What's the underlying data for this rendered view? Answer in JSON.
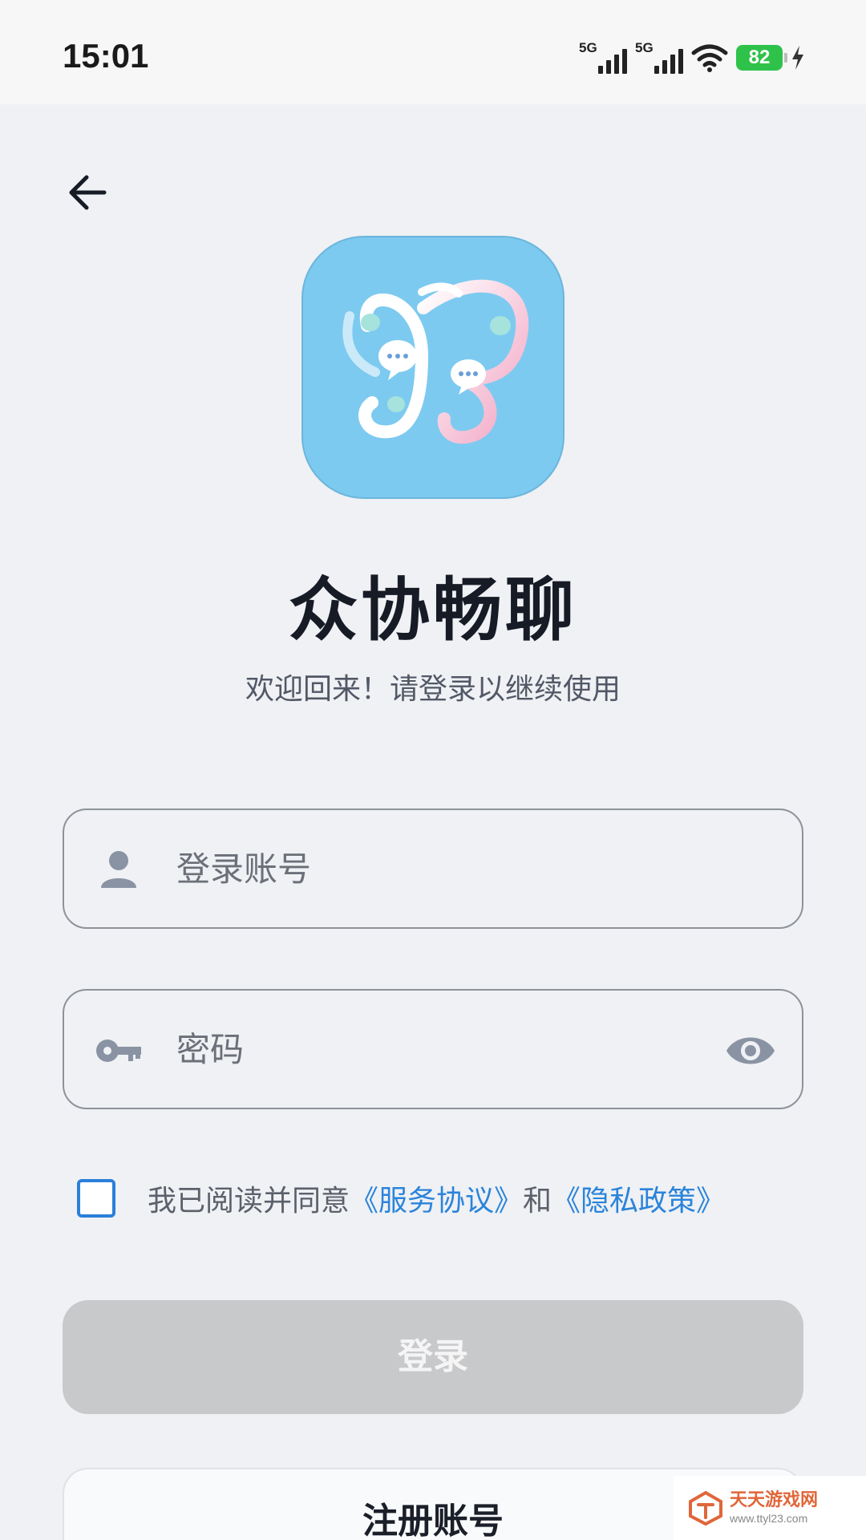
{
  "status_bar": {
    "time": "15:01",
    "network_1": "5G",
    "network_2": "5G",
    "battery": "82",
    "battery_color": "#2fc24a"
  },
  "header": {
    "back_icon": "arrow-left-icon"
  },
  "app": {
    "logo_icon": "butterfly-chat-logo",
    "logo_bg": "#7dcaf0",
    "name": "众协畅聊",
    "subtitle": "欢迎回来！请登录以继续使用"
  },
  "form": {
    "account": {
      "icon": "person-icon",
      "placeholder": "登录账号",
      "value": ""
    },
    "password": {
      "icon": "key-icon",
      "placeholder": "密码",
      "value": "",
      "toggle_icon": "eye-icon"
    }
  },
  "agreement": {
    "checked": false,
    "prefix": "我已阅读并同意",
    "terms_link": "《服务协议》",
    "conjunction": "和",
    "privacy_link": "《隐私政策》",
    "link_color": "#2b84da"
  },
  "buttons": {
    "login": "登录",
    "register": "注册账号"
  },
  "watermark": {
    "name": "天天游戏网",
    "url": "www.ttyl23.com"
  }
}
